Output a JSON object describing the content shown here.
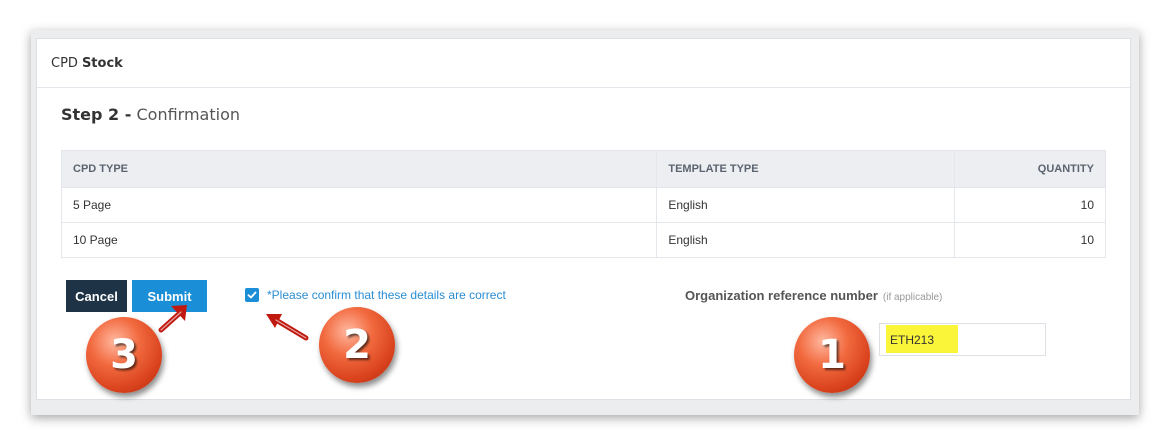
{
  "header": {
    "title_prefix": "CPD",
    "title_bold": "Stock"
  },
  "step": {
    "label": "Step 2 -",
    "name": "Confirmation"
  },
  "table": {
    "columns": [
      "CPD TYPE",
      "TEMPLATE TYPE",
      "QUANTITY"
    ],
    "rows": [
      {
        "cpd_type": "5 Page",
        "template_type": "English",
        "quantity": "10"
      },
      {
        "cpd_type": "10 Page",
        "template_type": "English",
        "quantity": "10"
      }
    ]
  },
  "actions": {
    "cancel_label": "Cancel",
    "submit_label": "Submit"
  },
  "confirm": {
    "checked": true,
    "label": "*Please confirm that these details are correct"
  },
  "org_ref": {
    "label": "Organization reference number",
    "hint": "(if applicable)",
    "value": "ETH213"
  },
  "annotations": {
    "badge_1": "1",
    "badge_2": "2",
    "badge_3": "3"
  },
  "colors": {
    "primary": "#1a8fd7",
    "dark": "#1f3347",
    "highlight": "#fbf53a",
    "badge": "#e8502a",
    "arrow": "#c0190f"
  }
}
